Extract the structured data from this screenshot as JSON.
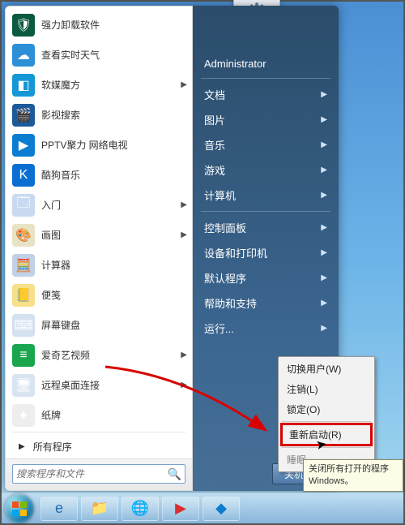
{
  "left": {
    "programs": [
      {
        "label": "强力卸载软件",
        "icon_bg": "#0b5a3f",
        "glyph": "🛡"
      },
      {
        "label": "查看实时天气",
        "icon_bg": "#2d8fd6",
        "glyph": "☁"
      },
      {
        "label": "软媒魔方",
        "icon_bg": "#1597d6",
        "glyph": "◧",
        "has_arrow": true
      },
      {
        "label": "影视搜索",
        "icon_bg": "#1d5a9a",
        "glyph": "🎬"
      },
      {
        "label": "PPTV聚力 网络电视",
        "icon_bg": "#0a7dd1",
        "glyph": "▶"
      },
      {
        "label": "酷狗音乐",
        "icon_bg": "#0a6fd1",
        "glyph": "K"
      },
      {
        "label": "入门",
        "icon_bg": "#c9d9ef",
        "glyph": "🗔",
        "has_arrow": true
      },
      {
        "label": "画图",
        "icon_bg": "#e9e3c6",
        "glyph": "🎨",
        "has_arrow": true
      },
      {
        "label": "计算器",
        "icon_bg": "#c0d1e8",
        "glyph": "🧮"
      },
      {
        "label": "便笺",
        "icon_bg": "#f6e08a",
        "glyph": "📒"
      },
      {
        "label": "屏幕键盘",
        "icon_bg": "#d4e1ef",
        "glyph": "⌨"
      },
      {
        "label": "爱奇艺视频",
        "icon_bg": "#1aa64f",
        "glyph": "≡",
        "has_arrow": true
      },
      {
        "label": "远程桌面连接",
        "icon_bg": "#d8e4f0",
        "glyph": "🖥",
        "has_arrow": true
      },
      {
        "label": "纸牌",
        "icon_bg": "#eeeeee",
        "glyph": "♠"
      }
    ],
    "all_programs": "所有程序",
    "search_placeholder": "搜索程序和文件"
  },
  "right": {
    "user": "Administrator",
    "items": [
      {
        "label": "文档"
      },
      {
        "label": "图片"
      },
      {
        "label": "音乐"
      },
      {
        "label": "游戏"
      },
      {
        "label": "计算机"
      },
      {
        "sep": true
      },
      {
        "label": "控制面板"
      },
      {
        "label": "设备和打印机"
      },
      {
        "label": "默认程序"
      },
      {
        "label": "帮助和支持"
      },
      {
        "label": "运行..."
      }
    ],
    "shutdown": "关机"
  },
  "ctx": {
    "items": [
      {
        "label": "切换用户(W)"
      },
      {
        "label": "注销(L)"
      },
      {
        "label": "锁定(O)"
      }
    ],
    "restart": "重新启动(R)",
    "sleep_partial": "睡眠"
  },
  "tooltip": "关闭所有打开的程序\nWindows。"
}
